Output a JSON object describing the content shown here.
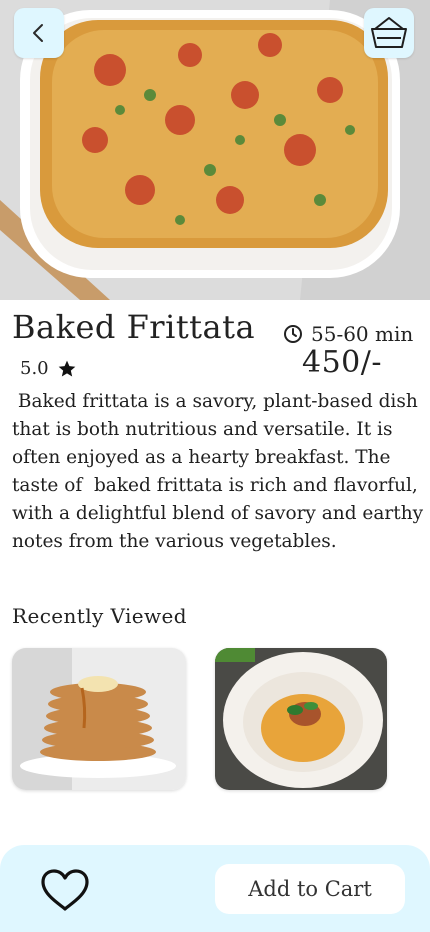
{
  "product": {
    "title": "Baked Frittata",
    "time": "55-60 min",
    "rating": "5.0",
    "price": "450/-",
    "description": " Baked frittata is a savory, plant-based dish that is both nutritious and versatile. It is often enjoyed as a hearty breakfast. The taste of  baked frittata is rich and flavorful, with a delightful blend of savory and earthy notes from the various vegetables."
  },
  "icons": {
    "back": "chevron-left-icon",
    "basket": "basket-icon",
    "clock": "clock-icon",
    "star": "star-icon",
    "favorite": "heart-icon"
  },
  "recent": {
    "title": "Recently Viewed",
    "items": [
      {
        "image": "pancake-stack-photo"
      },
      {
        "image": "spaghetti-bowl-photo"
      }
    ]
  },
  "actions": {
    "add_to_cart": "Add to Cart"
  },
  "colors": {
    "accent_bg": "#dff7ff",
    "text": "#1f1f1f",
    "white": "#ffffff"
  }
}
